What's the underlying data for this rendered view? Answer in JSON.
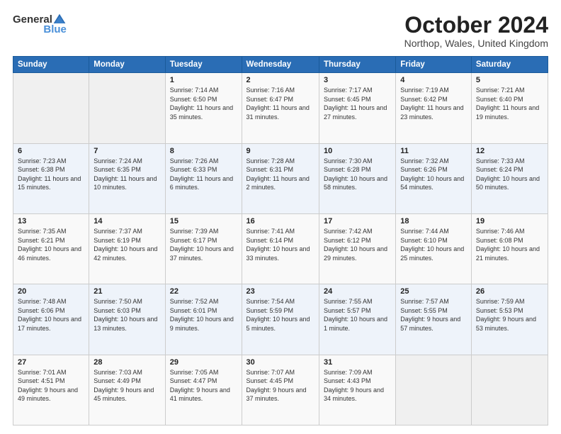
{
  "logo": {
    "text_general": "General",
    "text_blue": "Blue"
  },
  "title": "October 2024",
  "location": "Northop, Wales, United Kingdom",
  "days_of_week": [
    "Sunday",
    "Monday",
    "Tuesday",
    "Wednesday",
    "Thursday",
    "Friday",
    "Saturday"
  ],
  "weeks": [
    [
      {
        "day": "",
        "detail": ""
      },
      {
        "day": "",
        "detail": ""
      },
      {
        "day": "1",
        "detail": "Sunrise: 7:14 AM\nSunset: 6:50 PM\nDaylight: 11 hours and 35 minutes."
      },
      {
        "day": "2",
        "detail": "Sunrise: 7:16 AM\nSunset: 6:47 PM\nDaylight: 11 hours and 31 minutes."
      },
      {
        "day": "3",
        "detail": "Sunrise: 7:17 AM\nSunset: 6:45 PM\nDaylight: 11 hours and 27 minutes."
      },
      {
        "day": "4",
        "detail": "Sunrise: 7:19 AM\nSunset: 6:42 PM\nDaylight: 11 hours and 23 minutes."
      },
      {
        "day": "5",
        "detail": "Sunrise: 7:21 AM\nSunset: 6:40 PM\nDaylight: 11 hours and 19 minutes."
      }
    ],
    [
      {
        "day": "6",
        "detail": "Sunrise: 7:23 AM\nSunset: 6:38 PM\nDaylight: 11 hours and 15 minutes."
      },
      {
        "day": "7",
        "detail": "Sunrise: 7:24 AM\nSunset: 6:35 PM\nDaylight: 11 hours and 10 minutes."
      },
      {
        "day": "8",
        "detail": "Sunrise: 7:26 AM\nSunset: 6:33 PM\nDaylight: 11 hours and 6 minutes."
      },
      {
        "day": "9",
        "detail": "Sunrise: 7:28 AM\nSunset: 6:31 PM\nDaylight: 11 hours and 2 minutes."
      },
      {
        "day": "10",
        "detail": "Sunrise: 7:30 AM\nSunset: 6:28 PM\nDaylight: 10 hours and 58 minutes."
      },
      {
        "day": "11",
        "detail": "Sunrise: 7:32 AM\nSunset: 6:26 PM\nDaylight: 10 hours and 54 minutes."
      },
      {
        "day": "12",
        "detail": "Sunrise: 7:33 AM\nSunset: 6:24 PM\nDaylight: 10 hours and 50 minutes."
      }
    ],
    [
      {
        "day": "13",
        "detail": "Sunrise: 7:35 AM\nSunset: 6:21 PM\nDaylight: 10 hours and 46 minutes."
      },
      {
        "day": "14",
        "detail": "Sunrise: 7:37 AM\nSunset: 6:19 PM\nDaylight: 10 hours and 42 minutes."
      },
      {
        "day": "15",
        "detail": "Sunrise: 7:39 AM\nSunset: 6:17 PM\nDaylight: 10 hours and 37 minutes."
      },
      {
        "day": "16",
        "detail": "Sunrise: 7:41 AM\nSunset: 6:14 PM\nDaylight: 10 hours and 33 minutes."
      },
      {
        "day": "17",
        "detail": "Sunrise: 7:42 AM\nSunset: 6:12 PM\nDaylight: 10 hours and 29 minutes."
      },
      {
        "day": "18",
        "detail": "Sunrise: 7:44 AM\nSunset: 6:10 PM\nDaylight: 10 hours and 25 minutes."
      },
      {
        "day": "19",
        "detail": "Sunrise: 7:46 AM\nSunset: 6:08 PM\nDaylight: 10 hours and 21 minutes."
      }
    ],
    [
      {
        "day": "20",
        "detail": "Sunrise: 7:48 AM\nSunset: 6:06 PM\nDaylight: 10 hours and 17 minutes."
      },
      {
        "day": "21",
        "detail": "Sunrise: 7:50 AM\nSunset: 6:03 PM\nDaylight: 10 hours and 13 minutes."
      },
      {
        "day": "22",
        "detail": "Sunrise: 7:52 AM\nSunset: 6:01 PM\nDaylight: 10 hours and 9 minutes."
      },
      {
        "day": "23",
        "detail": "Sunrise: 7:54 AM\nSunset: 5:59 PM\nDaylight: 10 hours and 5 minutes."
      },
      {
        "day": "24",
        "detail": "Sunrise: 7:55 AM\nSunset: 5:57 PM\nDaylight: 10 hours and 1 minute."
      },
      {
        "day": "25",
        "detail": "Sunrise: 7:57 AM\nSunset: 5:55 PM\nDaylight: 9 hours and 57 minutes."
      },
      {
        "day": "26",
        "detail": "Sunrise: 7:59 AM\nSunset: 5:53 PM\nDaylight: 9 hours and 53 minutes."
      }
    ],
    [
      {
        "day": "27",
        "detail": "Sunrise: 7:01 AM\nSunset: 4:51 PM\nDaylight: 9 hours and 49 minutes."
      },
      {
        "day": "28",
        "detail": "Sunrise: 7:03 AM\nSunset: 4:49 PM\nDaylight: 9 hours and 45 minutes."
      },
      {
        "day": "29",
        "detail": "Sunrise: 7:05 AM\nSunset: 4:47 PM\nDaylight: 9 hours and 41 minutes."
      },
      {
        "day": "30",
        "detail": "Sunrise: 7:07 AM\nSunset: 4:45 PM\nDaylight: 9 hours and 37 minutes."
      },
      {
        "day": "31",
        "detail": "Sunrise: 7:09 AM\nSunset: 4:43 PM\nDaylight: 9 hours and 34 minutes."
      },
      {
        "day": "",
        "detail": ""
      },
      {
        "day": "",
        "detail": ""
      }
    ]
  ]
}
